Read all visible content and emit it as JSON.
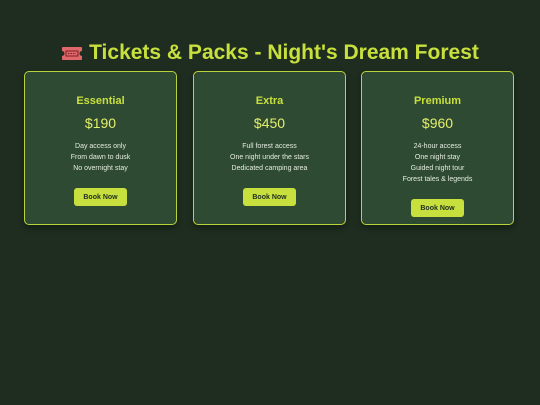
{
  "header": {
    "title": "Tickets & Packs - Night's Dream Forest",
    "icon": "ticket-icon"
  },
  "colors": {
    "background": "#1e2d20",
    "card": "#2f4a33",
    "accent": "#c8e03d",
    "ticket_icon": "#e0686b"
  },
  "plans": [
    {
      "name": "Essential",
      "price": "$190",
      "features": [
        "Day access only",
        "From dawn to dusk",
        "No overnight stay"
      ],
      "button": "Book Now"
    },
    {
      "name": "Extra",
      "price": "$450",
      "features": [
        "Full forest access",
        "One night under the stars",
        "Dedicated camping area"
      ],
      "button": "Book Now"
    },
    {
      "name": "Premium",
      "price": "$960",
      "features": [
        "24-hour access",
        "One night stay",
        "Guided night tour",
        "Forest tales & legends"
      ],
      "button": "Book Now"
    }
  ]
}
